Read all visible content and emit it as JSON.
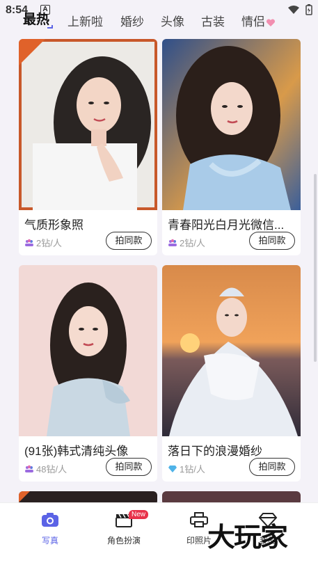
{
  "status_bar": {
    "time": "8:54",
    "notification_letter": "A"
  },
  "tabs": [
    {
      "label": "最热"
    },
    {
      "label": "上新啦"
    },
    {
      "label": "婚纱"
    },
    {
      "label": "头像"
    },
    {
      "label": "古装"
    },
    {
      "label": "情侣"
    }
  ],
  "cards": [
    {
      "title": "气质形象照",
      "cost": "2钻/人",
      "button": "拍同款",
      "cost_icon": "crowd-icon"
    },
    {
      "title": "青春阳光白月光微信...",
      "cost": "2钻/人",
      "button": "拍同款",
      "cost_icon": "crowd-icon"
    },
    {
      "title": "(91张)韩式清纯头像",
      "cost": "48钻/人",
      "button": "拍同款",
      "cost_icon": "crowd-icon"
    },
    {
      "title": "落日下的浪漫婚纱",
      "cost": "1钻/人",
      "button": "拍同款",
      "cost_icon": "diamond-icon"
    }
  ],
  "bottom_nav": [
    {
      "label": "写真",
      "icon": "camera-icon",
      "active": true
    },
    {
      "label": "角色扮演",
      "icon": "clapperboard-icon",
      "badge": "New"
    },
    {
      "label": "印照片",
      "icon": "printer-icon"
    },
    {
      "label": "我的",
      "icon": "diamond-icon"
    }
  ],
  "watermark": "大玩家",
  "colors": {
    "accent": "#5b63e6",
    "badge": "#e8324a",
    "corner": "#e0622a"
  }
}
